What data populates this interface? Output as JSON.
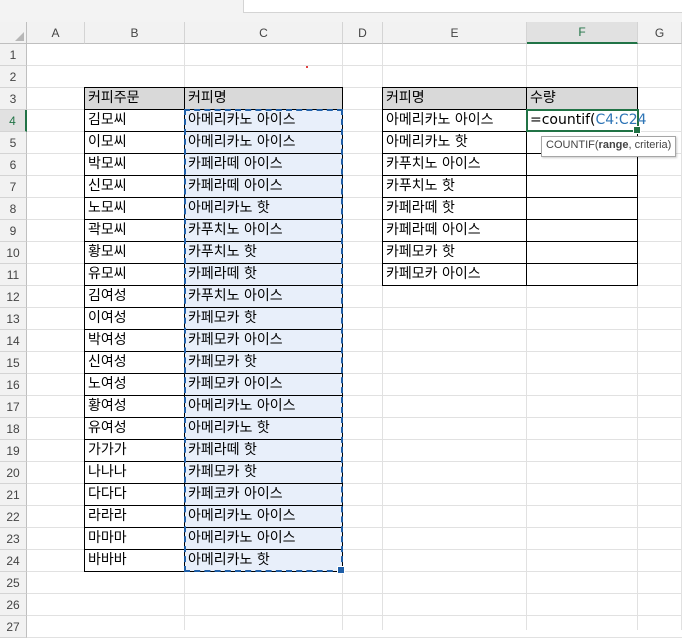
{
  "columns": [
    "A",
    "B",
    "C",
    "D",
    "E",
    "F",
    "G"
  ],
  "selected_column": "F",
  "rows": [
    "1",
    "2",
    "3",
    "4",
    "5",
    "6",
    "7",
    "8",
    "9",
    "10",
    "11",
    "12",
    "13",
    "14",
    "15",
    "16",
    "17",
    "18",
    "19",
    "20",
    "21",
    "22",
    "23",
    "24",
    "25",
    "26",
    "27"
  ],
  "selected_row": "4",
  "orders": {
    "header_name": "커피주문",
    "header_coffee": "커피명",
    "names": [
      "김모씨",
      "이모씨",
      "박모씨",
      "신모씨",
      "노모씨",
      "곽모씨",
      "황모씨",
      "유모씨",
      "김여성",
      "이여성",
      "박여성",
      "신여성",
      "노여성",
      "황여성",
      "유여성",
      "가가가",
      "나나나",
      "다다다",
      "라라라",
      "마마마",
      "바바바"
    ],
    "coffees": [
      "아메리카노 아이스",
      "아메리카노 아이스",
      "카페라떼 아이스",
      "카페라떼 아이스",
      "아메리카노 핫",
      "카푸치노 아이스",
      "카푸치노 핫",
      "카페라떼 핫",
      "카푸치노 아이스",
      "카페모카 핫",
      "카페모카 아이스",
      "카페모카 핫",
      "카페모카 아이스",
      "아메리카노 아이스",
      "아메리카노 핫",
      "카페라떼 핫",
      "카페모카 핫",
      "카페코카 아이스",
      "아메리카노 아이스",
      "아메리카노 아이스",
      "아메리카노 핫"
    ]
  },
  "summary": {
    "header_coffee": "커피명",
    "header_qty": "수량",
    "items": [
      "아메리카노 아이스",
      "아메리카노 핫",
      "카푸치노 아이스",
      "카푸치노 핫",
      "카페라떼 핫",
      "카페라떼 아이스",
      "카페모카 핫",
      "카페모카 아이스"
    ]
  },
  "formula": {
    "prefix": "=countif(",
    "ref": "C4:C24"
  },
  "tooltip": {
    "func": "COUNTIF(",
    "arg_bold": "range",
    "rest": ", criteria)"
  },
  "colors": {
    "header_fill": "#d9d9d9",
    "copy_marquee": "#1f5fa8",
    "active_border": "#217346",
    "ref_text": "#2e75b6"
  }
}
